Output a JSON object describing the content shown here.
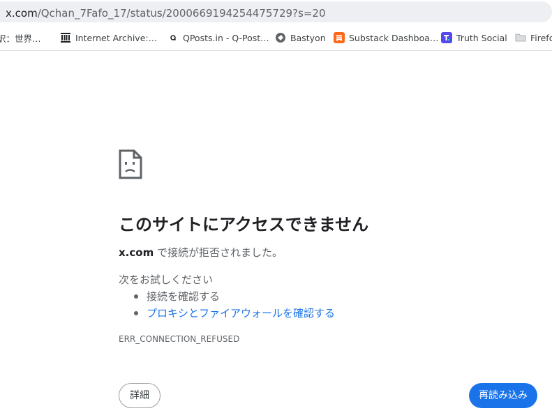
{
  "address_bar": {
    "host": "x.com",
    "path": "/Qchan_7Fafo_17/status/2000669194254475729?s=20"
  },
  "bookmarks": [
    {
      "icon": "translate-icon",
      "label": "訳：世界…"
    },
    {
      "icon": "internet-archive-icon",
      "label": "Internet Archive:…"
    },
    {
      "icon": "qposts-icon",
      "label": "QPosts.in - Q-Post…"
    },
    {
      "icon": "bastyon-icon",
      "label": "Bastyon"
    },
    {
      "icon": "substack-icon",
      "label": "Substack Dashboa…"
    },
    {
      "icon": "truth-social-icon",
      "label": "Truth Social"
    },
    {
      "icon": "folder-icon",
      "label": "Firefo"
    }
  ],
  "error": {
    "title": "このサイトにアクセスできません",
    "host": "x.com",
    "message": " で接続が拒否されました。",
    "try_label": "次をお試しください",
    "suggestions": [
      "接続を確認する",
      "プロキシとファイアウォールを確認する"
    ],
    "code": "ERR_CONNECTION_REFUSED"
  },
  "buttons": {
    "details": "詳細",
    "reload": "再読み込み"
  },
  "colors": {
    "link": "#1a73e8",
    "primary_button": "#1a73e8",
    "address_bar_bg": "#eeeff2"
  }
}
